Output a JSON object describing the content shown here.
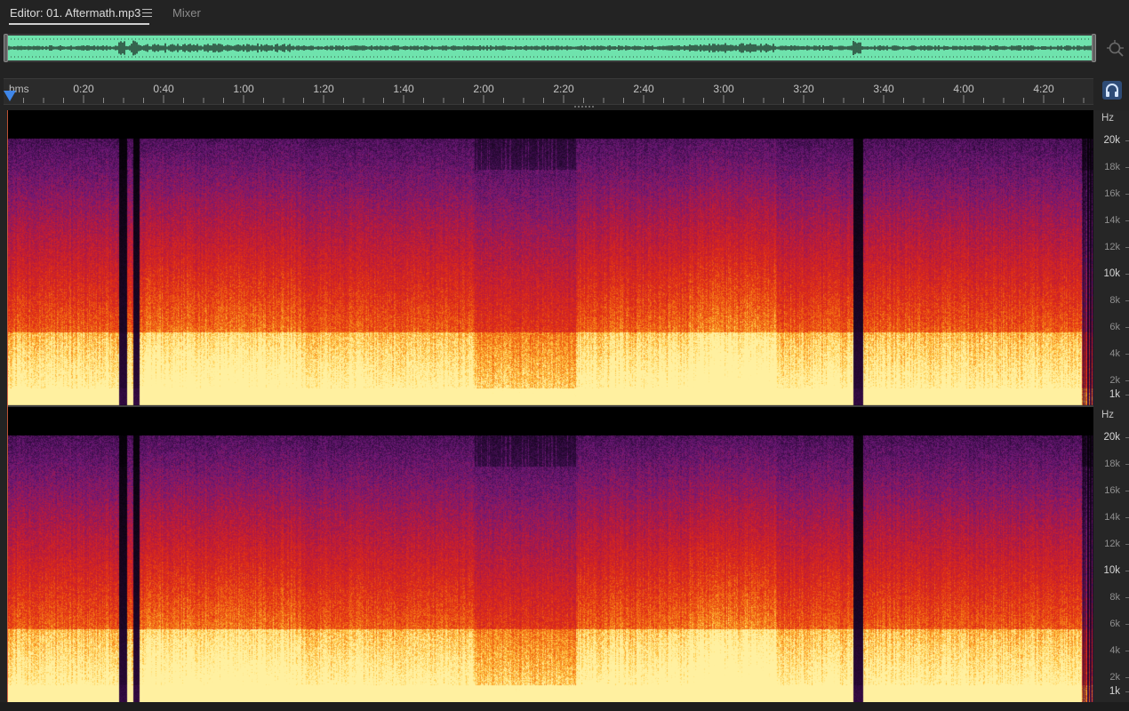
{
  "tabs": {
    "editor_label": "Editor: 01. Aftermath.mp3",
    "mixer_label": "Mixer"
  },
  "icons": {
    "tab_menu": "hamburger-icon",
    "zoom": "zoom-navigator-icon",
    "monitor": "headphones-icon"
  },
  "colors": {
    "overview_wave_bg": "#6fe3ad",
    "overview_wave": "#111111",
    "playhead": "#3f86e8",
    "accent_button": "#2e4c77"
  },
  "timeline": {
    "unit": "hms",
    "duration_sec": 283,
    "labels": [
      "0:20",
      "0:40",
      "1:00",
      "1:20",
      "1:40",
      "2:00",
      "2:20",
      "2:40",
      "3:00",
      "3:20",
      "3:40",
      "4:00",
      "4:20"
    ]
  },
  "frequency_scale": {
    "unit": "Hz",
    "labels": [
      "20k",
      "18k",
      "16k",
      "14k",
      "12k",
      "10k",
      "8k",
      "6k",
      "4k",
      "2k",
      "1k"
    ]
  },
  "channels": [
    "left",
    "right"
  ]
}
